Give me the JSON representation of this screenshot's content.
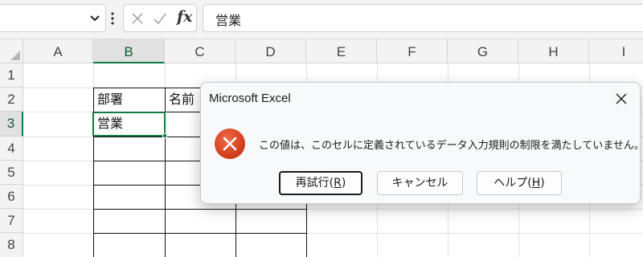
{
  "formula_bar": {
    "name_box_value": "",
    "cancel_icon": "cancel-icon",
    "enter_icon": "check-icon",
    "fx_label": "fx",
    "formula_value": "営業"
  },
  "grid": {
    "columns": [
      "A",
      "B",
      "C",
      "D",
      "E",
      "F",
      "G",
      "H",
      "I"
    ],
    "rows": [
      "1",
      "2",
      "3",
      "4",
      "5",
      "6",
      "7",
      "8"
    ],
    "selected_column": "B",
    "selected_row": "3",
    "cells": {
      "B2": "部署",
      "C2": "名前",
      "B3": "営業"
    }
  },
  "dialog": {
    "title": "Microsoft Excel",
    "message": "この値は、このセルに定義されているデータ入力規則の制限を満たしていません。",
    "icon": "error-icon",
    "buttons": {
      "retry_text": "再試行(",
      "retry_key": "R",
      "retry_close": ")",
      "cancel_text": "キャンセル",
      "help_text": "ヘルプ(",
      "help_key": "H",
      "help_close": ")"
    },
    "colors": {
      "error_red": "#d53b1f",
      "excel_green": "#107c41"
    }
  }
}
